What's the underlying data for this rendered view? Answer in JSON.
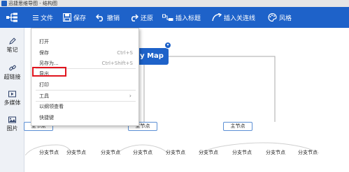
{
  "titlebar": {
    "title": "迅捷思维导图 - 结构图"
  },
  "toolbar": {
    "file": "文件",
    "save": "保存",
    "undo": "撤销",
    "redo": "还原",
    "insert_title": "插入标题",
    "insert_relation": "插入关连线",
    "style": "风格"
  },
  "sidebar": {
    "items": [
      {
        "label": "笔记",
        "icon": "pencil-icon"
      },
      {
        "label": "超链接",
        "icon": "link-icon"
      },
      {
        "label": "多媒体",
        "icon": "media-icon"
      },
      {
        "label": "图片",
        "icon": "image-icon"
      }
    ]
  },
  "menu": {
    "items": [
      {
        "label": "打开",
        "shortcut": ""
      },
      {
        "label": "保存",
        "shortcut": "Ctrl+S"
      },
      {
        "label": "另存为...",
        "shortcut": "Ctrl+Shift+S"
      },
      {
        "label": "导出",
        "shortcut": ""
      },
      {
        "label": "打印",
        "shortcut": ""
      },
      {
        "label": "工具",
        "shortcut": ""
      },
      {
        "label": "以纲领查看",
        "shortcut": ""
      },
      {
        "label": "快捷键",
        "shortcut": ""
      }
    ]
  },
  "canvas": {
    "central_topic": "y Map",
    "main_node": "主节点",
    "sub_node": "分支节点"
  },
  "colors": {
    "accent": "#1e62c9",
    "highlight": "#e0141e"
  }
}
